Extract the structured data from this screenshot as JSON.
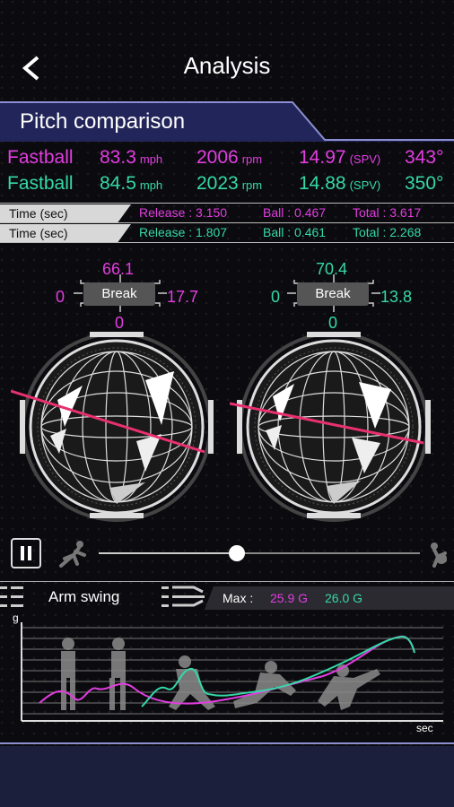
{
  "header": {
    "title": "Analysis",
    "back_icon": "chevron-left-icon"
  },
  "section": {
    "title": "Pitch comparison"
  },
  "pitches": [
    {
      "type": "Fastball",
      "speed": "83.3",
      "speed_unit": "mph",
      "spin": "2006",
      "spin_unit": "rpm",
      "spv": "14.97",
      "spv_unit": "(SPV)",
      "angle": "343°",
      "color": "#e23de0"
    },
    {
      "type": "Fastball",
      "speed": "84.5",
      "speed_unit": "mph",
      "spin": "2023",
      "spin_unit": "rpm",
      "spv": "14.88",
      "spv_unit": "(SPV)",
      "angle": "350°",
      "color": "#35d9a6"
    }
  ],
  "times": [
    {
      "label": "Time (sec)",
      "release": "Release : 3.150",
      "ball": "Ball : 0.467",
      "total": "Total : 3.617"
    },
    {
      "label": "Time (sec)",
      "release": "Release : 1.807",
      "ball": "Ball : 0.461",
      "total": "Total : 2.268"
    }
  ],
  "breaks": [
    {
      "top": "66.1",
      "left": "0",
      "right": "17.7",
      "bottom": "0",
      "label": "Break"
    },
    {
      "top": "70.4",
      "left": "0",
      "right": "13.8",
      "bottom": "0",
      "label": "Break"
    }
  ],
  "playback": {
    "progress": 0.43
  },
  "arm_swing": {
    "label": "Arm swing",
    "max_label": "Max :",
    "max1": "25.9 G",
    "max2": "26.0 G",
    "y_label": "g",
    "x_label": "sec"
  }
}
